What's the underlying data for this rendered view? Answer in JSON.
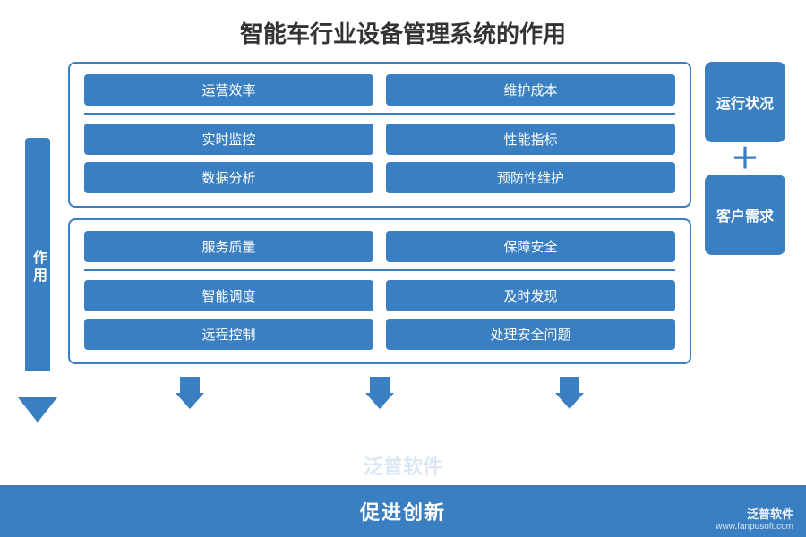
{
  "title": "智能车行业设备管理系统的作用",
  "left_label": "作用",
  "card1": {
    "header": [
      "运营效率",
      "维护成本"
    ],
    "row1": [
      "实时监控",
      "性能指标"
    ],
    "row2": [
      "数据分析",
      "预防性维护"
    ]
  },
  "card2": {
    "header": [
      "服务质量",
      "保障安全"
    ],
    "row1": [
      "智能调度",
      "及时发现"
    ],
    "row2": [
      "远程控制",
      "处理安全问题"
    ]
  },
  "right": {
    "box1": "运行状况",
    "plus": "＋",
    "box2": "客户需求"
  },
  "bottom": "促进创新",
  "brand_name": "泛普软件",
  "brand_url": "www.fanpusoft.com",
  "watermark": "泛普软件"
}
